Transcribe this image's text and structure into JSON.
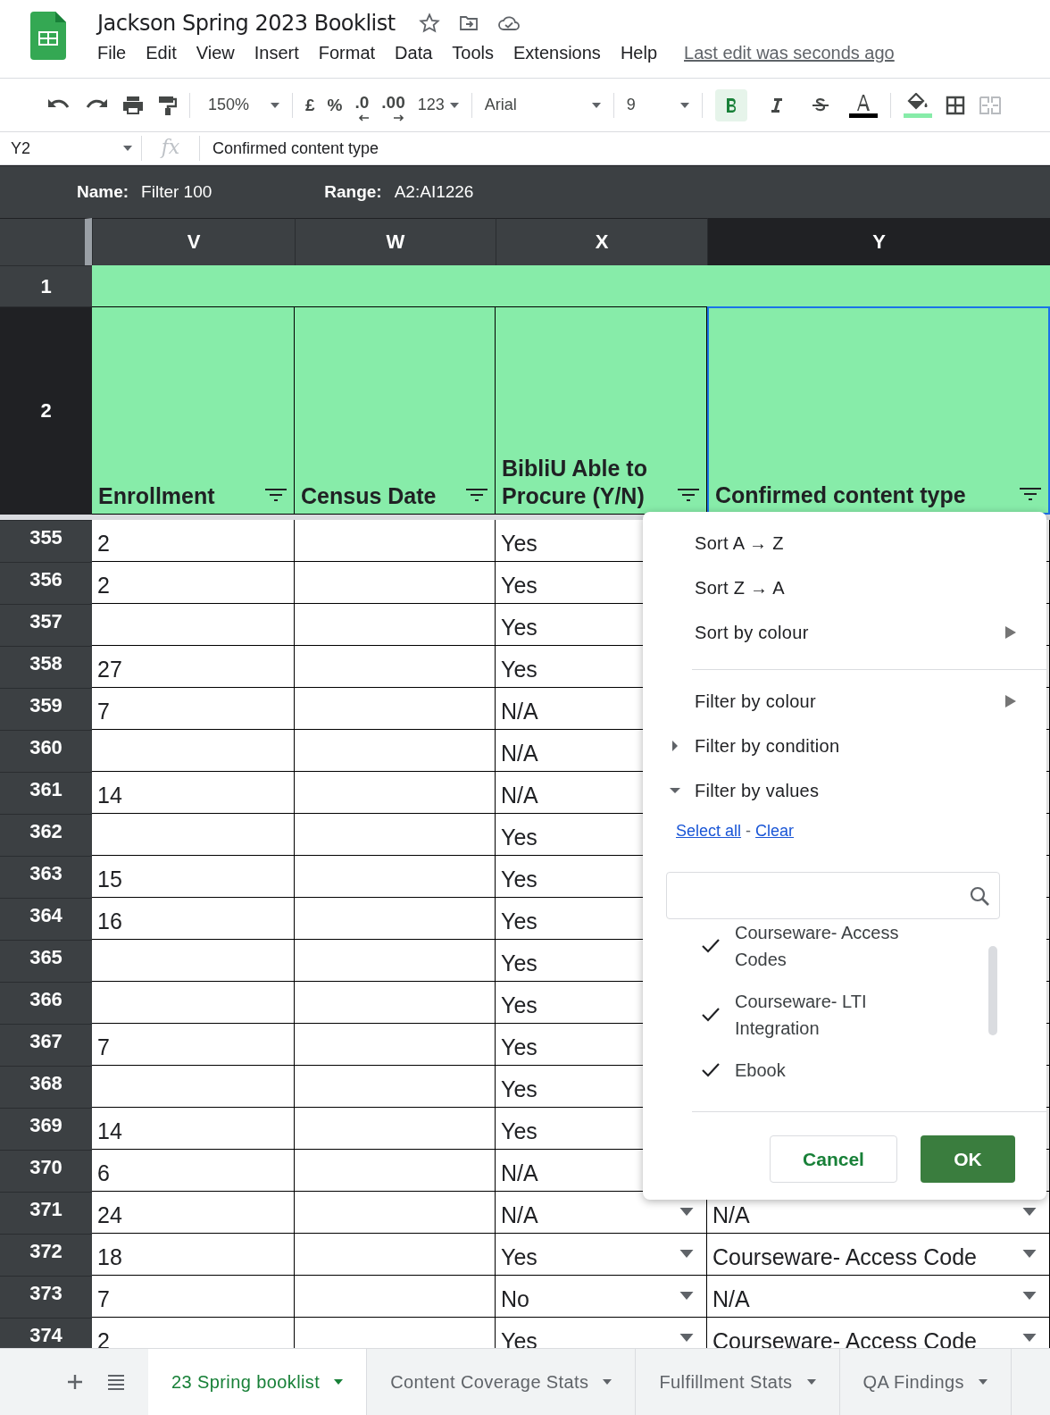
{
  "doc": {
    "title": "Jackson Spring 2023 Booklist",
    "last_edit": "Last edit was seconds ago"
  },
  "menu_bar": [
    "File",
    "Edit",
    "View",
    "Insert",
    "Format",
    "Data",
    "Tools",
    "Extensions",
    "Help"
  ],
  "toolbar": {
    "zoom": "150%",
    "currency": "£",
    "percent": "%",
    "decrease_decimals": ".0",
    "increase_decimals": ".00",
    "number_format": "123",
    "font": "Arial",
    "font_size": "9",
    "bold_active": true,
    "italic_active": false,
    "strike_active": false,
    "merge_disabled": true
  },
  "formula_bar": {
    "cell_ref": "Y2",
    "fx": "fx",
    "value": "Confirmed content type"
  },
  "filter_bar": {
    "name_label": "Name:",
    "name": "Filter 100",
    "range_label": "Range:",
    "range": "A2:AI1226"
  },
  "columns": [
    {
      "letter": "V",
      "selected": false
    },
    {
      "letter": "W",
      "selected": false
    },
    {
      "letter": "X",
      "selected": false
    },
    {
      "letter": "Y",
      "selected": true
    }
  ],
  "header_rows": [
    {
      "number": "1",
      "selected": false,
      "cells": []
    },
    {
      "number": "2",
      "selected": true,
      "cells": [
        {
          "text": "Enrollment",
          "selected": false
        },
        {
          "text": "Census Date",
          "selected": false
        },
        {
          "text": "BibliU Able to Procure (Y/N)",
          "selected": false
        },
        {
          "text": "Confirmed content type",
          "selected": true
        }
      ]
    }
  ],
  "rows": [
    {
      "number": "355",
      "enrollment": "2",
      "procure": "Yes"
    },
    {
      "number": "356",
      "enrollment": "2",
      "procure": "Yes"
    },
    {
      "number": "357",
      "procure": "Yes"
    },
    {
      "number": "358",
      "enrollment": "27",
      "procure": "Yes"
    },
    {
      "number": "359",
      "enrollment": "7",
      "procure": "N/A"
    },
    {
      "number": "360",
      "procure": "N/A"
    },
    {
      "number": "361",
      "enrollment": "14",
      "procure": "N/A"
    },
    {
      "number": "362",
      "procure": "Yes"
    },
    {
      "number": "363",
      "enrollment": "15",
      "procure": "Yes"
    },
    {
      "number": "364",
      "enrollment": "16",
      "procure": "Yes"
    },
    {
      "number": "365",
      "procure": "Yes"
    },
    {
      "number": "366",
      "procure": "Yes"
    },
    {
      "number": "367",
      "enrollment": "7",
      "procure": "Yes"
    },
    {
      "number": "368",
      "procure": "Yes"
    },
    {
      "number": "369",
      "enrollment": "14",
      "procure": "Yes"
    },
    {
      "number": "370",
      "enrollment": "6",
      "procure": "N/A"
    },
    {
      "number": "371",
      "enrollment": "24",
      "procure": "N/A",
      "content_type": "N/A",
      "dropdowns": true
    },
    {
      "number": "372",
      "enrollment": "18",
      "procure": "Yes",
      "content_type": "Courseware- Access Code",
      "dropdowns": true
    },
    {
      "number": "373",
      "enrollment": "7",
      "procure": "No",
      "content_type": "N/A",
      "dropdowns": true
    },
    {
      "number": "374",
      "enrollment": "2",
      "procure": "Yes",
      "content_type": "Courseware- Access Code",
      "dropdowns": true
    }
  ],
  "filter_menu": {
    "items": [
      {
        "kind": "action",
        "label": "Sort A → Z"
      },
      {
        "kind": "action",
        "label": "Sort Z → A"
      },
      {
        "kind": "submenu",
        "label": "Sort by colour"
      },
      {
        "kind": "divider"
      },
      {
        "kind": "submenu",
        "label": "Filter by colour"
      },
      {
        "kind": "section",
        "label": "Filter by condition",
        "expanded": false
      },
      {
        "kind": "section",
        "label": "Filter by values",
        "expanded": true
      }
    ],
    "select_all": "Select all",
    "separator": "-",
    "clear": "Clear",
    "values": [
      {
        "label": "Courseware- Access Codes",
        "checked": true
      },
      {
        "label": "Courseware- LTI Integration",
        "checked": true
      },
      {
        "label": "Ebook",
        "checked": true
      }
    ],
    "buttons": [
      {
        "label": "Cancel",
        "kind": "secondary"
      },
      {
        "label": "OK",
        "kind": "primary"
      }
    ]
  },
  "sheet_tabs": [
    {
      "label": "23 Spring booklist",
      "selected": true
    },
    {
      "label": "Content Coverage Stats",
      "selected": false
    },
    {
      "label": "Fulfillment Stats",
      "selected": false
    },
    {
      "label": "QA Findings",
      "selected": false
    }
  ]
}
